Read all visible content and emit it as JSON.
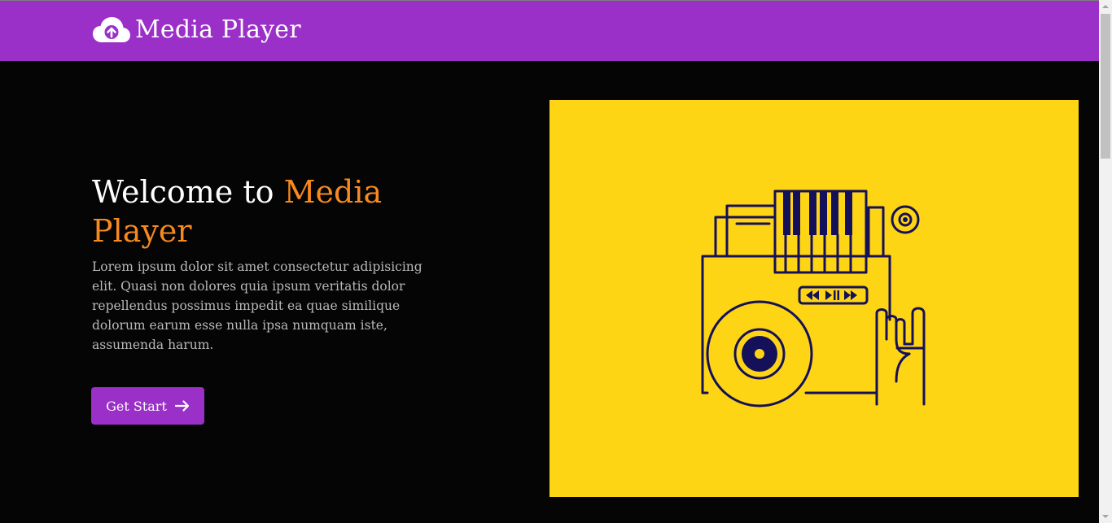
{
  "navbar": {
    "brand_icon": "cloud-upload-icon",
    "brand_text": "Media Player",
    "background_color": "#9b30c9"
  },
  "hero": {
    "title_prefix": "Welcome to ",
    "title_accent": "Media Player",
    "accent_color": "#f7891f",
    "description": "Lorem ipsum dolor sit amet consectetur adipisicing elit. Quasi non dolores quia ipsum veritatis dolor repellendus possimus impedit ea quae similique dolorum earum esse nulla ipsa numquam iste, assumenda harum.",
    "button_label": "Get Start",
    "button_icon": "arrow-right-icon"
  },
  "illustration": {
    "description_icon": "music-player-illustration",
    "background_color": "#fed514",
    "line_color": "#15105a"
  }
}
